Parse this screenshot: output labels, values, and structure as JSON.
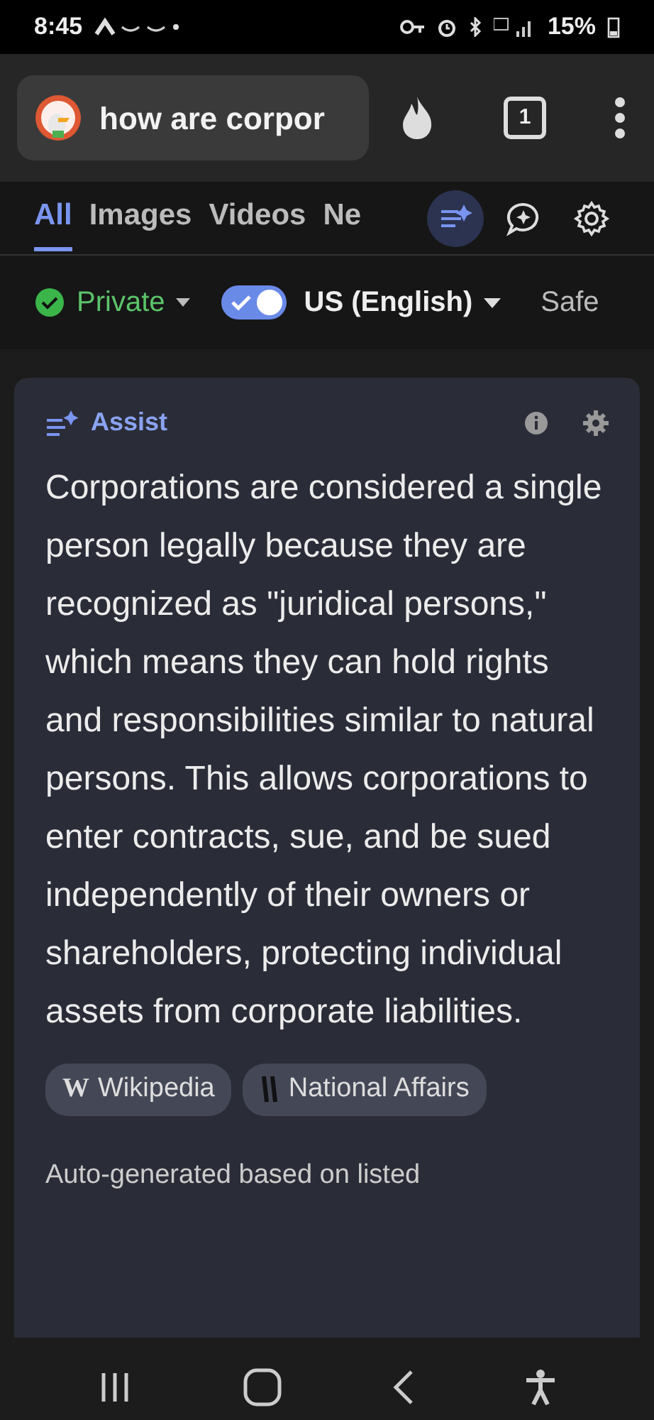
{
  "status_bar": {
    "time": "8:45",
    "battery": "15%"
  },
  "address_bar": {
    "query": "how are corpor",
    "tab_count": "1"
  },
  "tabs": [
    {
      "label": "All",
      "selected": true
    },
    {
      "label": "Images",
      "selected": false
    },
    {
      "label": "Videos",
      "selected": false
    },
    {
      "label": "Ne",
      "selected": false
    }
  ],
  "tab_tools": [
    {
      "kind": "assist",
      "selected": true
    },
    {
      "kind": "chat",
      "selected": false
    },
    {
      "kind": "settings",
      "selected": false
    }
  ],
  "filters": {
    "privacy": {
      "label": "Private"
    },
    "region": {
      "label": "US (English)",
      "on": true
    },
    "safe_search": {
      "label": "Safe"
    }
  },
  "assist": {
    "title": "Assist",
    "answer": "Corporations are considered a single person legally because they are recognized as \"juridical persons,\" which means they can hold rights and responsibilities similar to natural persons. This allows corporations to enter contracts, sue, and be sued independently of their owners or shareholders, protecting individual assets from corporate liabilities.",
    "sources": [
      {
        "kind": "letter",
        "icon_text": "W",
        "label": "Wikipedia"
      },
      {
        "kind": "bars",
        "label": "National Affairs"
      }
    ],
    "footer": "Auto-generated based on listed"
  }
}
